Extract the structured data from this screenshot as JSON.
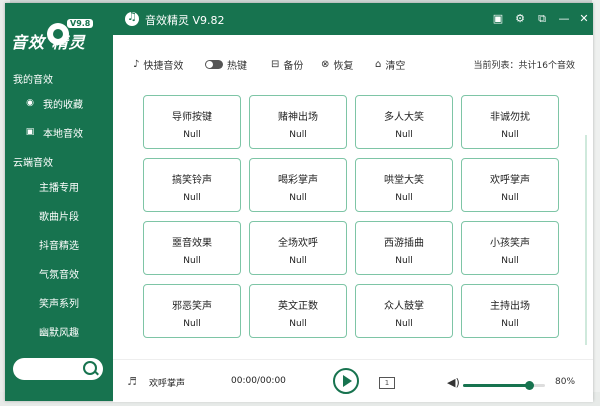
{
  "app": {
    "title": "音效精灵 V9.82",
    "logo_text": "音效  精灵",
    "logo_badge": "V9.8"
  },
  "sidebar": {
    "section_my": "我的音效",
    "my_items": [
      {
        "label": "我的收藏",
        "icon": "favorite-icon"
      },
      {
        "label": "本地音效",
        "icon": "local-file-icon"
      }
    ],
    "section_cloud": "云端音效",
    "cloud_items": [
      {
        "label": "主播专用"
      },
      {
        "label": "歌曲片段"
      },
      {
        "label": "抖音精选"
      },
      {
        "label": "气氛音效"
      },
      {
        "label": "笑声系列"
      },
      {
        "label": "幽默风趣"
      }
    ]
  },
  "toolbar": {
    "shortcut_label": "快捷音效",
    "hotkey_label": "热键",
    "hotkey_on": false,
    "backup_label": "备份",
    "restore_label": "恢复",
    "clear_label": "清空",
    "list_info": "当前列表：共计16个音效"
  },
  "sounds": [
    {
      "name": "导师按键",
      "key": "Null"
    },
    {
      "name": "赌神出场",
      "key": "Null"
    },
    {
      "name": "多人大笑",
      "key": "Null"
    },
    {
      "name": "非诚勿扰",
      "key": "Null"
    },
    {
      "name": "搞笑铃声",
      "key": "Null"
    },
    {
      "name": "喝彩掌声",
      "key": "Null"
    },
    {
      "name": "哄堂大笑",
      "key": "Null"
    },
    {
      "name": "欢呼掌声",
      "key": "Null"
    },
    {
      "name": "噩音效果",
      "key": "Null"
    },
    {
      "name": "全场欢呼",
      "key": "Null"
    },
    {
      "name": "西游插曲",
      "key": "Null"
    },
    {
      "name": "小孩笑声",
      "key": "Null"
    },
    {
      "name": "邪恶笑声",
      "key": "Null"
    },
    {
      "name": "英文正数",
      "key": "Null"
    },
    {
      "name": "众人鼓掌",
      "key": "Null"
    },
    {
      "name": "主持出场",
      "key": "Null"
    }
  ],
  "player": {
    "track": "欢呼掌声",
    "time": "00:00/00:00",
    "loop_label": "1",
    "volume_label": "80%",
    "volume": 0.8
  },
  "colors": {
    "brand": "#17734f",
    "card_border": "#7ec5a6"
  }
}
